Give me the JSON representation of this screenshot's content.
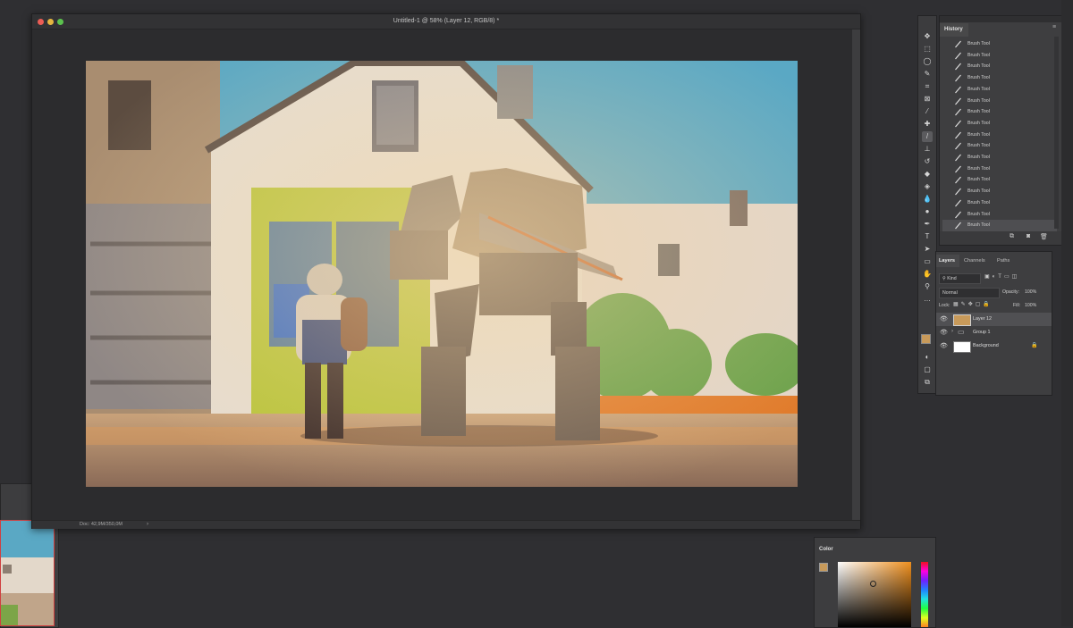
{
  "document": {
    "title": "Untitled-1 @ 58% (Layer 12, RGB/8) *",
    "status": "Doc: 42,9M/350,0M",
    "status_arrow": "›"
  },
  "history": {
    "title": "History",
    "items": [
      "Brush Tool",
      "Brush Tool",
      "Brush Tool",
      "Brush Tool",
      "Brush Tool",
      "Brush Tool",
      "Brush Tool",
      "Brush Tool",
      "Brush Tool",
      "Brush Tool",
      "Brush Tool",
      "Brush Tool",
      "Brush Tool",
      "Brush Tool",
      "Brush Tool",
      "Brush Tool",
      "Brush Tool"
    ]
  },
  "layers": {
    "tabs": [
      "Layers",
      "Channels",
      "Paths"
    ],
    "kind_label": "Kind",
    "blend_mode": "Normal",
    "opacity_label": "Opacity:",
    "opacity_value": "100%",
    "lock_label": "Lock:",
    "fill_label": "Fill:",
    "fill_value": "100%",
    "items": [
      {
        "name": "Layer 12"
      },
      {
        "name": "Group 1"
      },
      {
        "name": "Background"
      }
    ]
  },
  "color": {
    "title": "Color",
    "foreground": "#c89a5a",
    "background": "#2a7ad0"
  },
  "colors": {
    "sky": "#5aa8c4",
    "wall": "#e6ddd0",
    "door": "#b8c43a",
    "ground": "#b88a62",
    "accent": "#e07a2a"
  }
}
